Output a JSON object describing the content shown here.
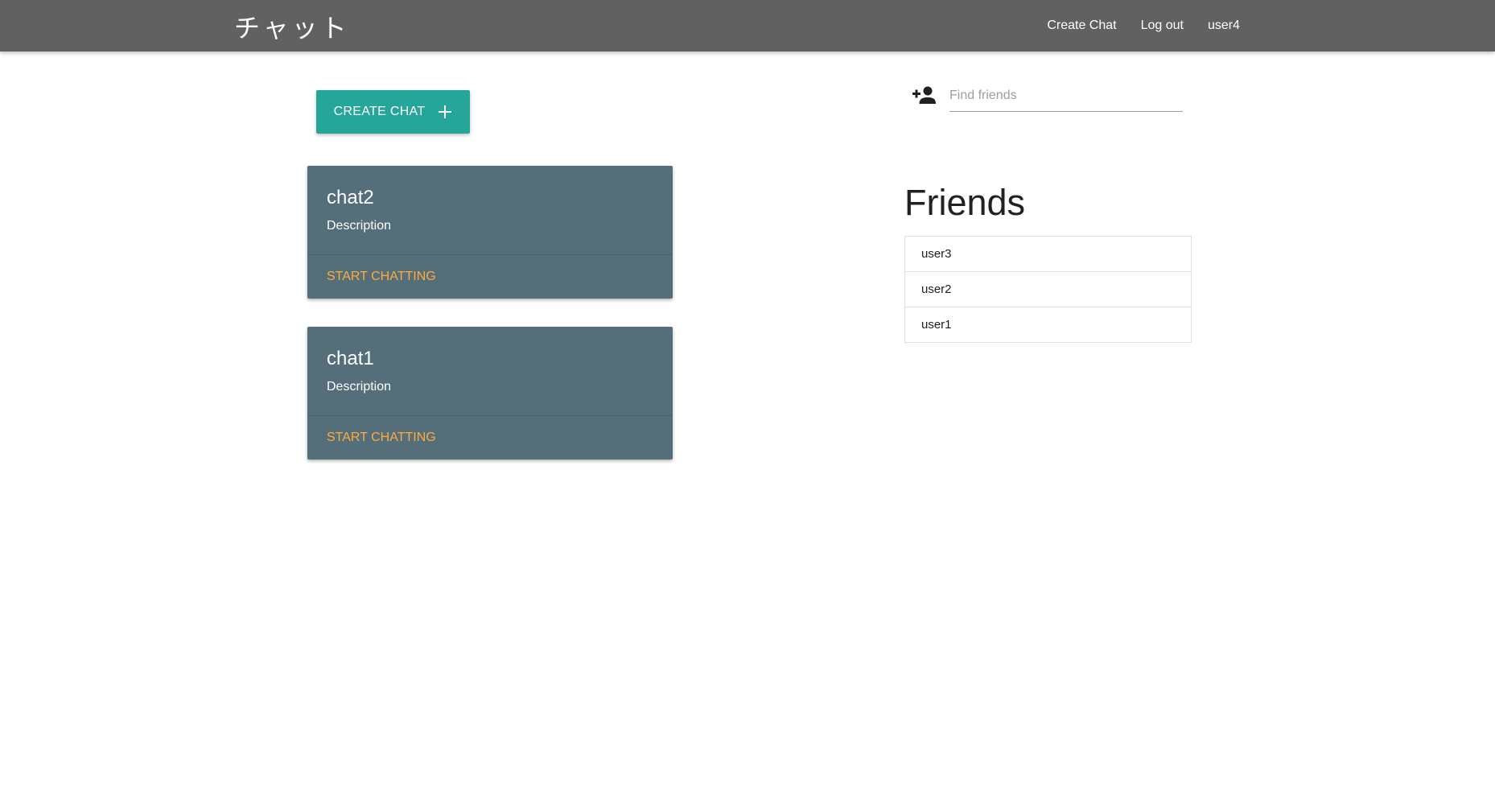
{
  "navbar": {
    "brand": "チャット",
    "links": [
      "Create Chat",
      "Log out",
      "user4"
    ]
  },
  "create_button": {
    "label": "CREATE CHAT",
    "icon": "plus-icon"
  },
  "chats": [
    {
      "title": "chat2",
      "description": "Description",
      "action": "START CHATTING"
    },
    {
      "title": "chat1",
      "description": "Description",
      "action": "START CHATTING"
    }
  ],
  "find_friends": {
    "icon": "person-add-icon",
    "placeholder": "Find friends",
    "value": ""
  },
  "friends": {
    "title": "Friends",
    "items": [
      "user3",
      "user2",
      "user1"
    ]
  },
  "colors": {
    "navbar": "#616161",
    "create_button": "#26a69a",
    "card": "#546e7a",
    "card_action": "#ffab40"
  }
}
